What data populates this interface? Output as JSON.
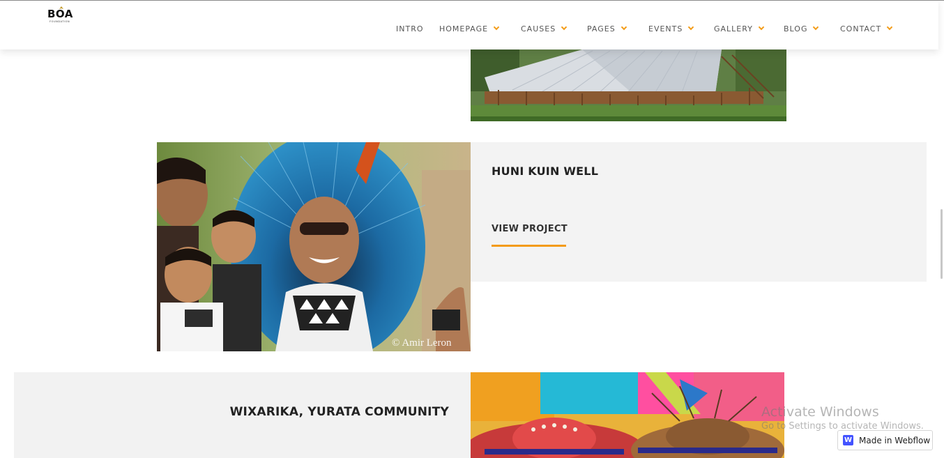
{
  "logo": {
    "text": "BOA",
    "subtext": "FOUNDATION"
  },
  "nav": [
    {
      "label": "INTRO",
      "dropdown": false
    },
    {
      "label": "HOMEPAGE",
      "dropdown": true
    },
    {
      "label": "CAUSES",
      "dropdown": true
    },
    {
      "label": "PAGES",
      "dropdown": true
    },
    {
      "label": "EVENTS",
      "dropdown": true
    },
    {
      "label": "GALLERY",
      "dropdown": true
    },
    {
      "label": "BLOG",
      "dropdown": true
    },
    {
      "label": "CONTACT",
      "dropdown": true
    }
  ],
  "projects": [
    {
      "title": "HUNI KUIN WELL",
      "link_label": "VIEW PROJECT",
      "image_caption": "© Amir Leron"
    },
    {
      "title": "WIXARIKA, YURATA COMMUNITY"
    }
  ],
  "overlay": {
    "activate_title": "Activate Windows",
    "activate_sub": "Go to Settings to activate Windows.",
    "webflow_label": "Made in Webflow",
    "webflow_icon": "W"
  },
  "colors": {
    "accent": "#f39b17",
    "card_bg": "#f3f3f3",
    "webflow_blue": "#4353ff"
  }
}
